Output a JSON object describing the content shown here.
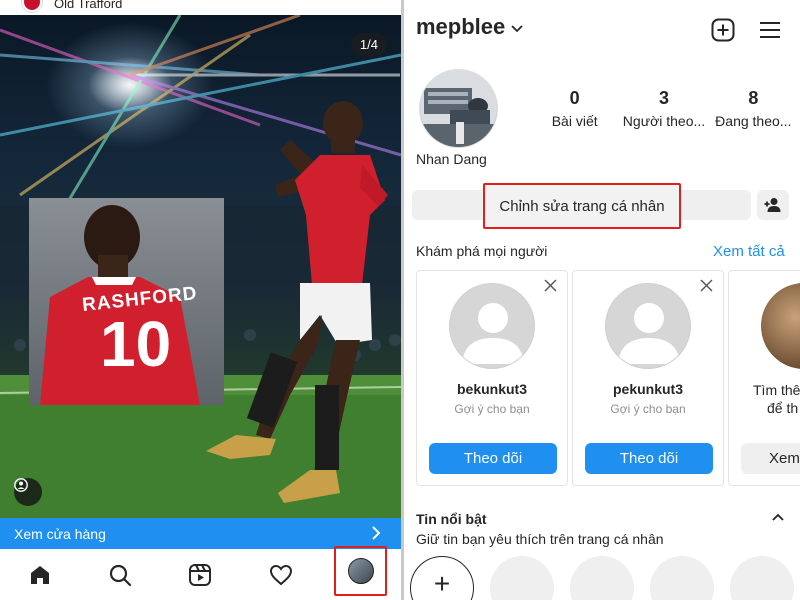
{
  "left": {
    "location_text": "Old Trafford",
    "post_counter": "1/4",
    "jersey_name": "RASHFORD",
    "jersey_number": "10",
    "shop_label": "Xem cửa hàng",
    "nav": [
      "home-icon",
      "search-icon",
      "reels-icon",
      "heart-icon",
      "profile-avatar"
    ]
  },
  "profile": {
    "username": "mepblee",
    "display_name": "Nhan Dang",
    "stats": [
      {
        "value": "0",
        "label": "Bài viết"
      },
      {
        "value": "3",
        "label": "Người theo..."
      },
      {
        "value": "8",
        "label": "Đang theo..."
      }
    ],
    "edit_button": "Chỉnh sửa trang cá nhân"
  },
  "discover": {
    "title": "Khám phá mọi người",
    "see_all": "Xem tất cả",
    "cards": [
      {
        "name": "bekunkut3",
        "subtitle": "Gợi ý cho bạn",
        "button": "Theo dõi"
      },
      {
        "name": "pekunkut3",
        "subtitle": "Gợi ý cho bạn",
        "button": "Theo dõi"
      }
    ],
    "card3": {
      "line1": "Tìm thê",
      "line2": "để th",
      "button": "Xem"
    }
  },
  "highlights": {
    "title": "Tin nổi bật",
    "subtitle": "Giữ tin bạn yêu thích trên trang cá nhân",
    "new_label": "+"
  },
  "colors": {
    "accent_blue": "#1f8ff0",
    "highlight_red": "#e01e1e",
    "jersey_red": "#c8102e"
  }
}
